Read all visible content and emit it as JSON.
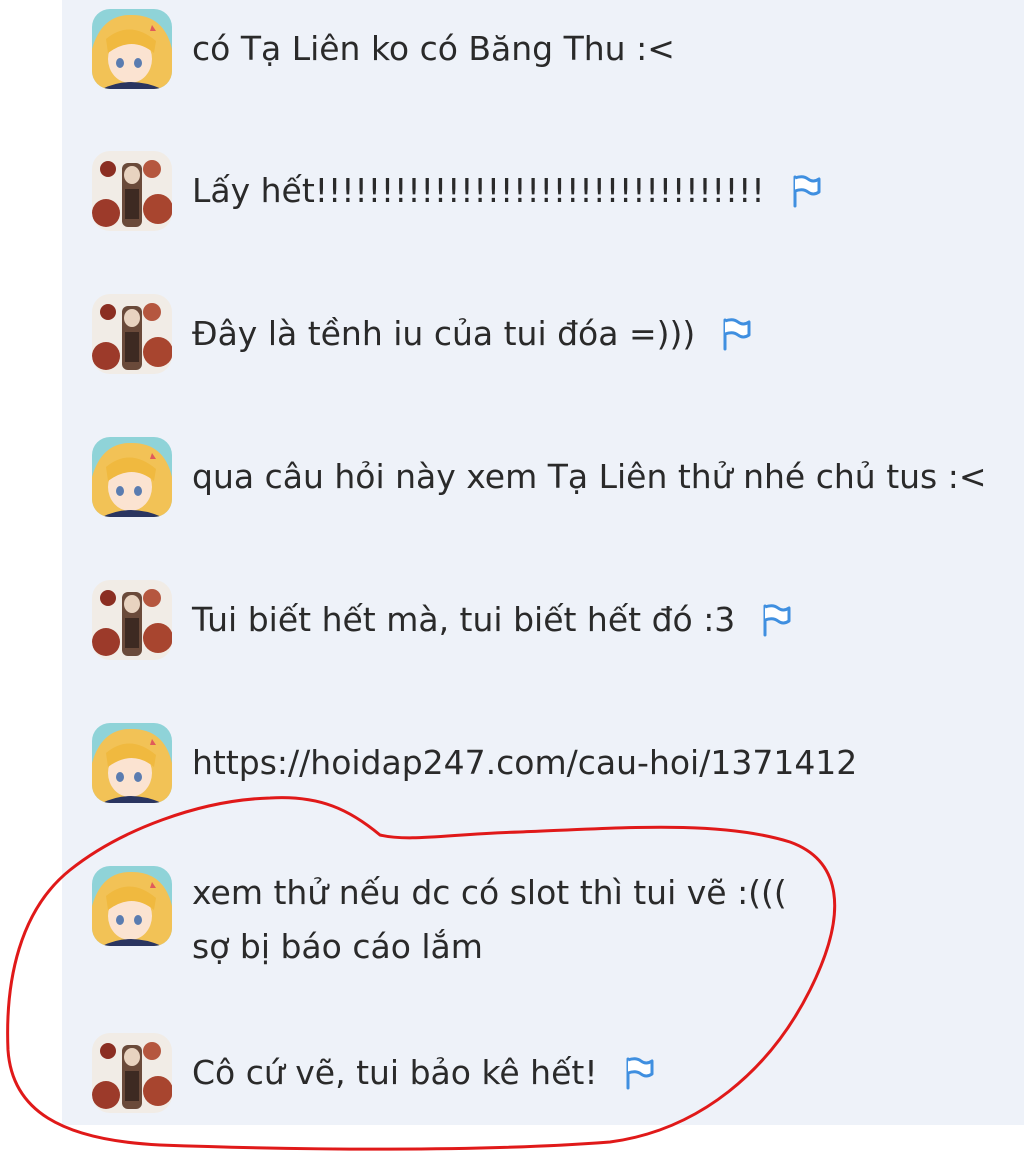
{
  "messages": [
    {
      "text": "có Tạ Liên ko có Băng Thu :<",
      "avatar": "blonde-avatar",
      "flag": false
    },
    {
      "text": "Lấy hết!!!!!!!!!!!!!!!!!!!!!!!!!!!!!!!!!!",
      "avatar": "redflower-avatar",
      "flag": true
    },
    {
      "text": "Đây là tềnh iu của tui đóa =)))",
      "avatar": "redflower-avatar",
      "flag": true
    },
    {
      "text": "qua câu hỏi này xem Tạ Liên thử nhé chủ tus :<",
      "avatar": "blonde-avatar",
      "flag": false
    },
    {
      "text": "Tui biết hết mà, tui biết hết đó :3",
      "avatar": "redflower-avatar",
      "flag": true
    },
    {
      "text": "https://hoidap247.com/cau-hoi/1371412",
      "avatar": "blonde-avatar",
      "flag": false
    },
    {
      "text": "xem thử nếu dc có slot thì tui vẽ :(((\nsợ bị báo cáo lắm",
      "avatar": "blonde-avatar",
      "flag": false
    },
    {
      "text": "Cô cứ vẽ, tui bảo kê hết!",
      "avatar": "redflower-avatar",
      "flag": true
    }
  ],
  "colors": {
    "panel_bg": "#eef2f9",
    "flag": "#3f8fe0",
    "highlight_circle": "#e01919"
  },
  "icons": {
    "flag": "flag-icon"
  }
}
